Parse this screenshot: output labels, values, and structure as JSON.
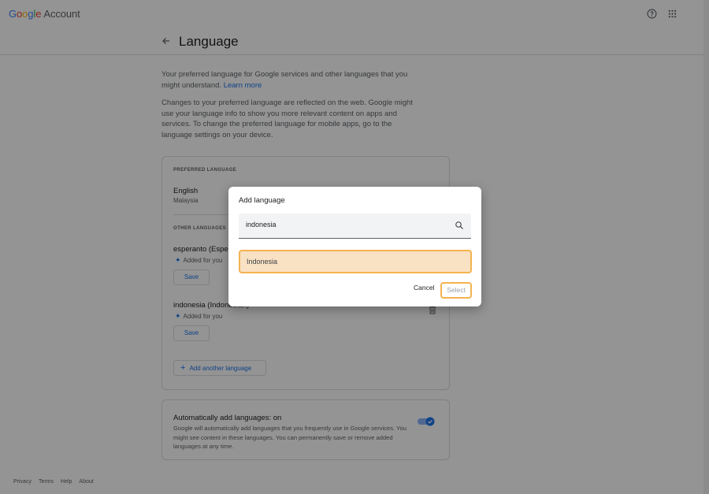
{
  "topbar": {
    "logo": [
      "G",
      "o",
      "o",
      "g",
      "l",
      "e"
    ],
    "account_label": "Account"
  },
  "header": {
    "title": "Language"
  },
  "intro": {
    "text1": "Your preferred language for Google services and other languages that you might understand. ",
    "learn_more": "Learn more",
    "text2": "Changes to your preferred language are reflected on the web. Google might use your language info to show you more relevant content on apps and services. To change the preferred language for mobile apps, go to the language settings on your device."
  },
  "card": {
    "preferred_label": "PREFERRED LANGUAGE",
    "preferred_name": "English",
    "preferred_region": "Malaysia",
    "other_label": "OTHER LANGUAGES",
    "languages": [
      {
        "name": "esperanto (Esperanto)",
        "added": "Added for you",
        "save": "Save"
      },
      {
        "name": "indonesia (Indonesian)",
        "added": "Added for you",
        "save": "Save"
      }
    ],
    "add_another": "Add another language"
  },
  "auto": {
    "title": "Automatically add languages: on",
    "desc": "Google will automatically add languages that you frequently use in Google services. You might see content in these languages. You can permanently save or remove added languages at any time."
  },
  "footer": {
    "links": [
      "Privacy",
      "Terms",
      "Help",
      "About"
    ]
  },
  "dialog": {
    "title": "Add language",
    "search_value": "indonesia",
    "result": "Indonesia",
    "cancel": "Cancel",
    "select": "Select"
  },
  "colors": {
    "accent": "#1a73e8",
    "highlight_border": "#f4b350",
    "highlight_fill": "#f9e1c3"
  }
}
